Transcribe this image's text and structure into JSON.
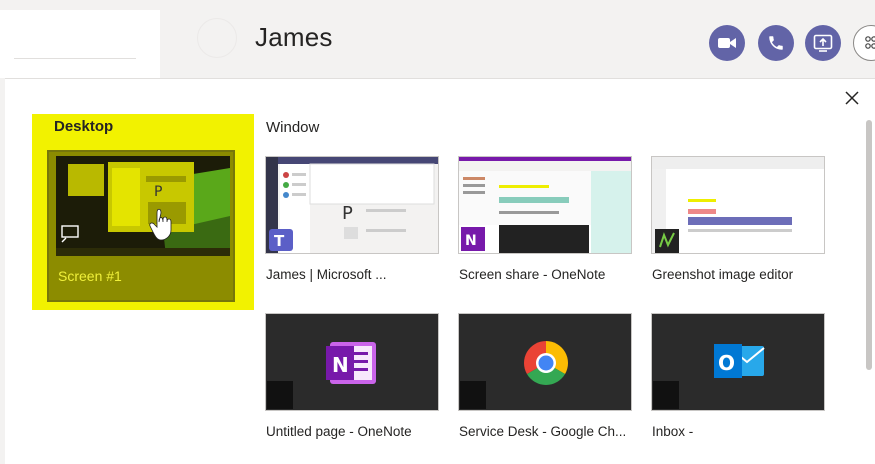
{
  "header": {
    "chat_title": "James",
    "buttons": [
      "video-call-icon",
      "audio-call-icon",
      "share-screen-icon",
      "participants-icon"
    ]
  },
  "share_tray": {
    "desktop": {
      "section_title": "Desktop",
      "screens": [
        {
          "label": "Screen #1",
          "selected": true
        }
      ]
    },
    "window": {
      "section_title": "Window",
      "windows": [
        {
          "caption": "James        | Microsoft ...",
          "app": "teams"
        },
        {
          "caption": "Screen share - OneNote",
          "app": "onenote"
        },
        {
          "caption": "Greenshot image editor",
          "app": "greenshot"
        },
        {
          "caption": "Untitled page - OneNote",
          "app": "onenote"
        },
        {
          "caption": "Service Desk - Google Ch...",
          "app": "chrome"
        },
        {
          "caption": "Inbox -",
          "app": "outlook"
        }
      ]
    }
  },
  "colors": {
    "teams_purple": "#6264a7",
    "selection_yellow": "#f2f200",
    "onenote_purple": "#7719aa",
    "outlook_blue": "#0078d4"
  }
}
